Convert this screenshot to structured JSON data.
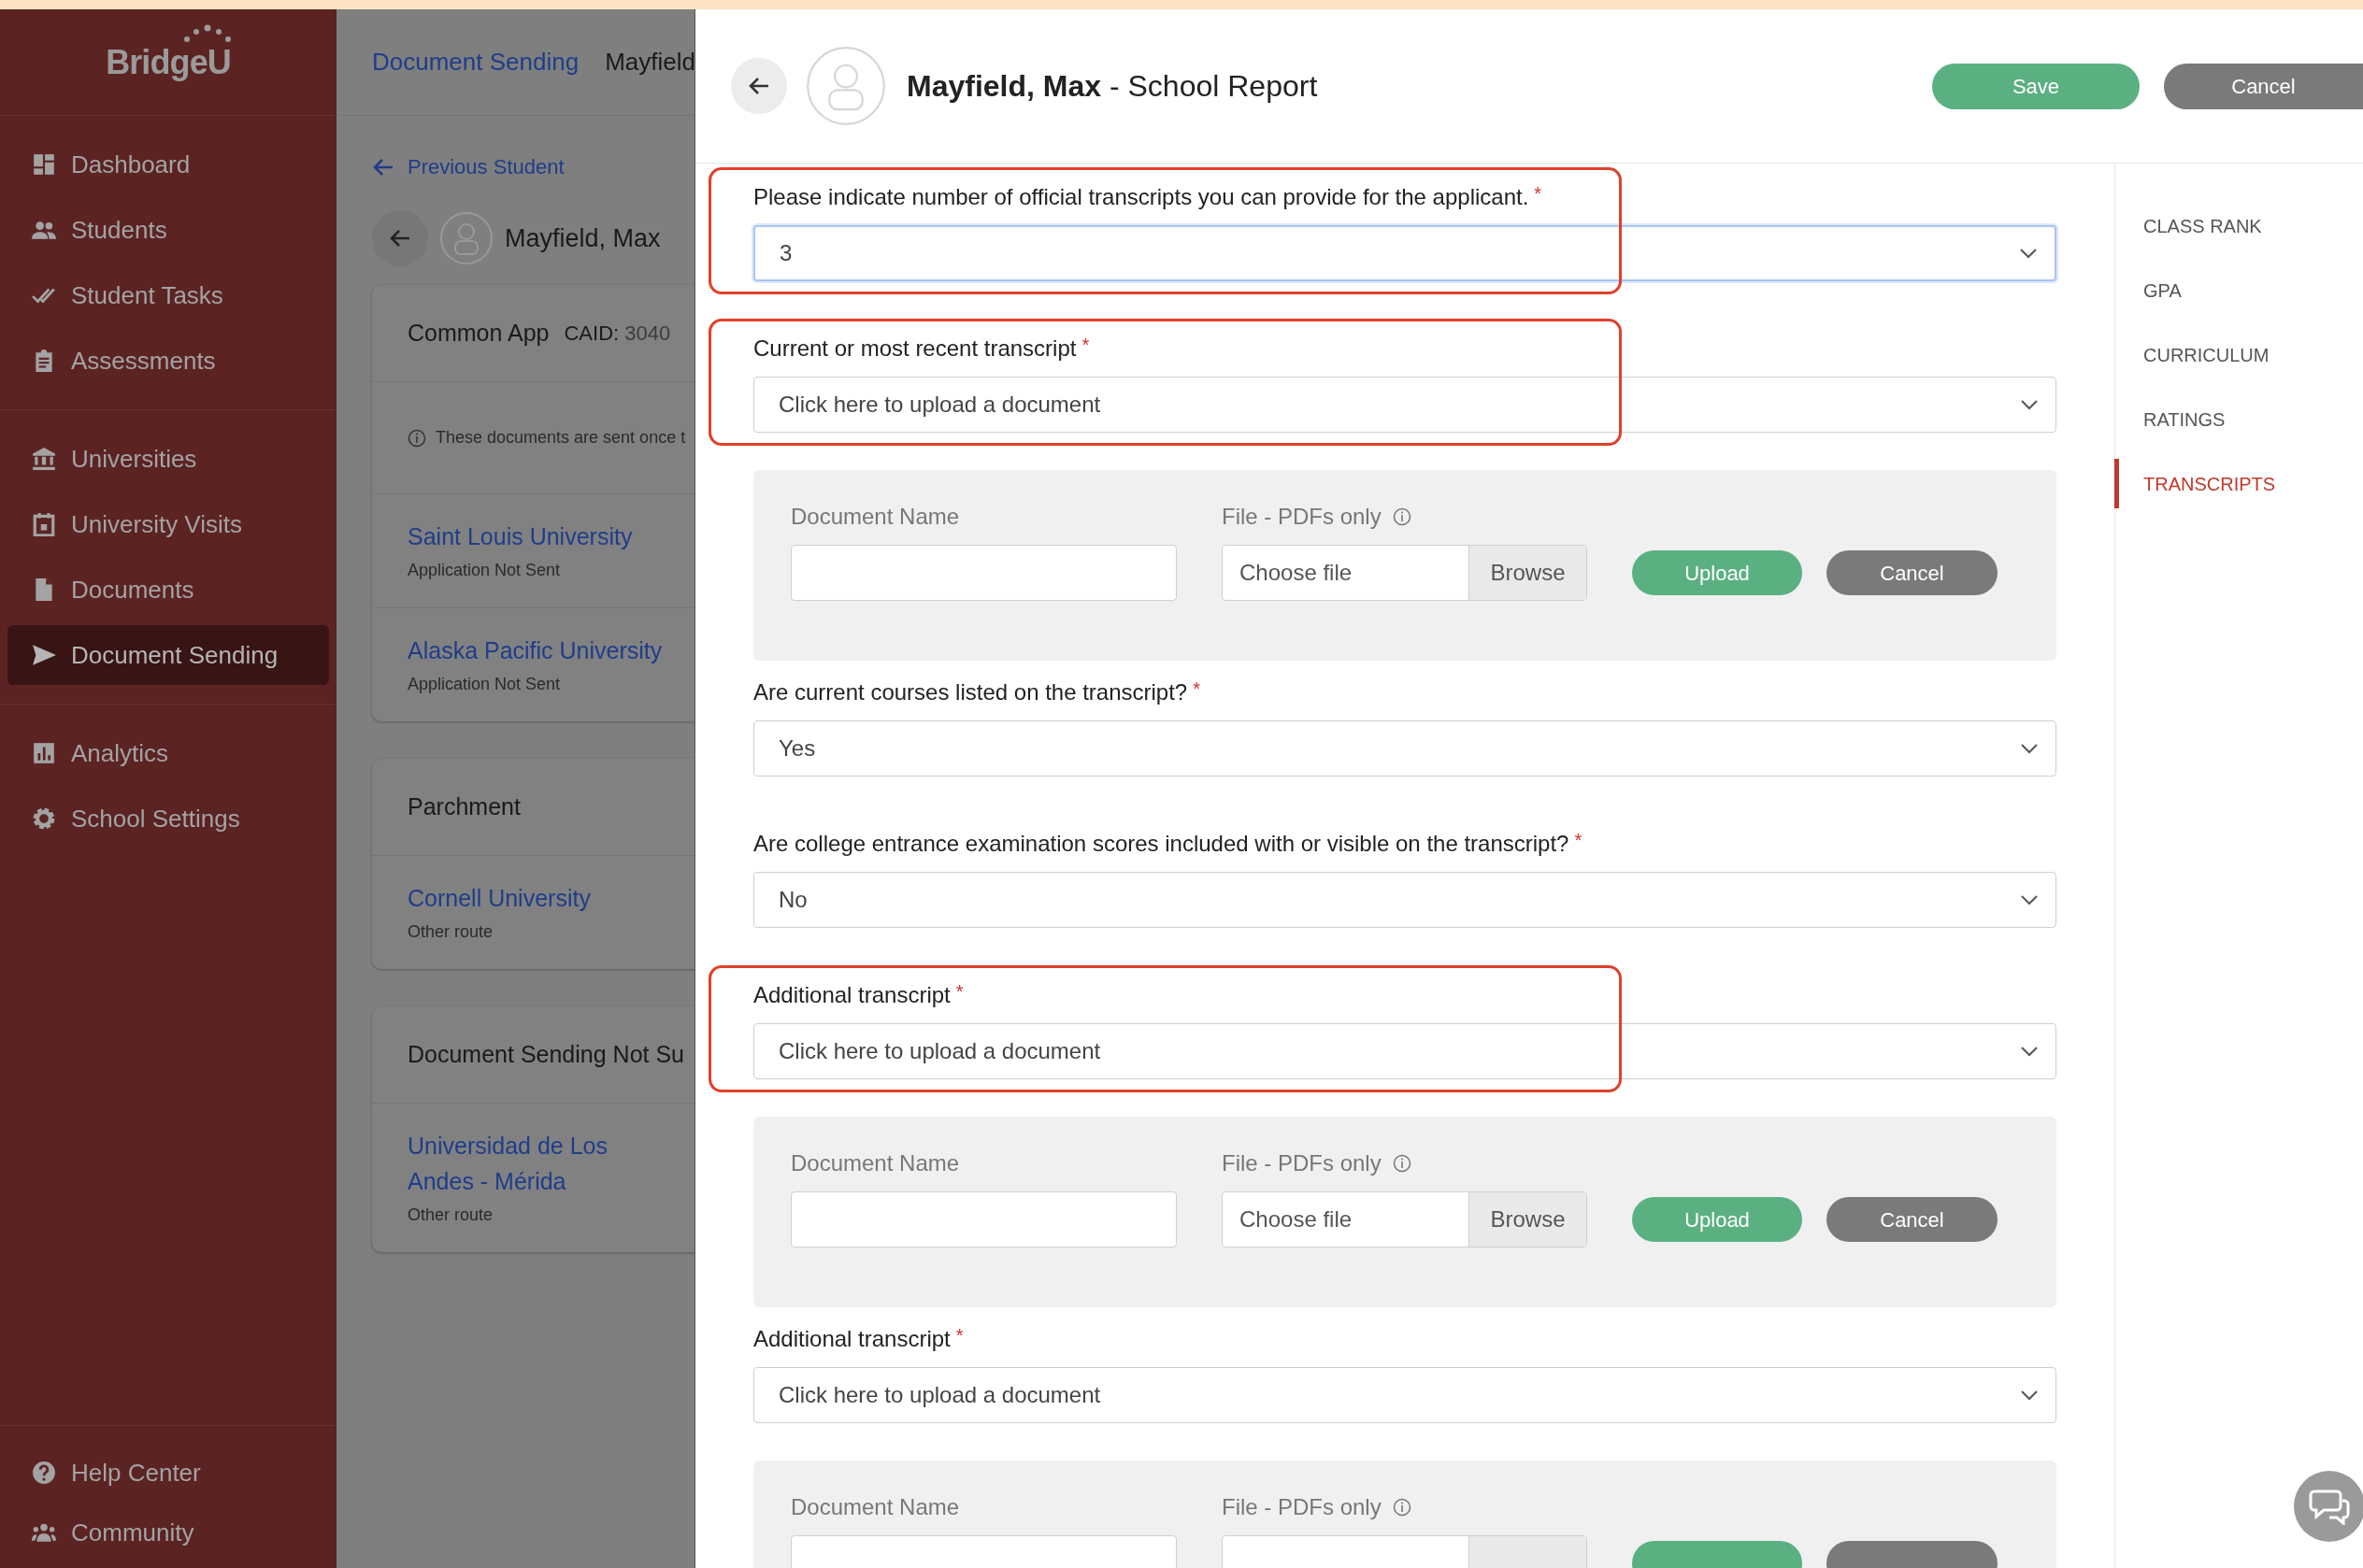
{
  "sidebar": {
    "logo": "BridgeU",
    "groups": [
      [
        {
          "label": "Dashboard",
          "selected": false
        },
        {
          "label": "Students",
          "selected": false
        },
        {
          "label": "Student Tasks",
          "selected": false
        },
        {
          "label": "Assessments",
          "selected": false
        }
      ],
      [
        {
          "label": "Universities",
          "selected": false
        },
        {
          "label": "University Visits",
          "selected": false
        },
        {
          "label": "Documents",
          "selected": false
        },
        {
          "label": "Document Sending",
          "selected": true
        }
      ],
      [
        {
          "label": "Analytics",
          "selected": false
        },
        {
          "label": "School Settings",
          "selected": false
        }
      ]
    ],
    "footer": [
      {
        "label": "Help Center"
      },
      {
        "label": "Community"
      }
    ]
  },
  "background_page": {
    "breadcrumb": [
      "Document Sending",
      "Mayfield"
    ],
    "previous_link": "Previous Student",
    "student_name": "Mayfield, Max",
    "cards": [
      {
        "title": "Common App",
        "caid_label": "CAID:",
        "caid_value": "3040",
        "note": "These documents are sent once t",
        "entries": [
          {
            "name": "Saint Louis University",
            "status": "Application Not Sent"
          },
          {
            "name": "Alaska Pacific University",
            "status": "Application Not Sent"
          }
        ]
      },
      {
        "title": "Parchment",
        "entries": [
          {
            "name": "Cornell University",
            "status": "Other route"
          }
        ]
      },
      {
        "title": "Document Sending Not Su",
        "entries": [
          {
            "name": "Universidad de Los Andes - Mérida",
            "status": "Other route"
          }
        ]
      }
    ]
  },
  "modal": {
    "title": "**Mayfield, Max** - School Report",
    "save": "Save",
    "cancel": "Cancel",
    "nav": [
      {
        "label": "CLASS RANK",
        "selected": false
      },
      {
        "label": "GPA",
        "selected": false
      },
      {
        "label": "CURRICULUM",
        "selected": false
      },
      {
        "label": "RATINGS",
        "selected": false
      },
      {
        "label": "TRANSCRIPTS",
        "selected": true
      }
    ],
    "fields": [
      {
        "kind": "select",
        "label": "Please indicate number of official transcripts you can provide for the applicant.",
        "required_mark": "*",
        "value": "3",
        "focused": true,
        "highlighted": true
      },
      {
        "kind": "select",
        "label": "Current or most recent transcript",
        "required_mark": "*",
        "value": "Click here to upload a document",
        "focused": false,
        "highlighted": true
      },
      {
        "kind": "upload",
        "name_label": "Document Name",
        "file_label": "File - PDFs only",
        "choose": "Choose file",
        "browse": "Browse",
        "upload": "Upload",
        "cancel": "Cancel"
      },
      {
        "kind": "select",
        "label": "Are current courses listed on the transcript?",
        "required_mark": "*",
        "value": "Yes",
        "focused": false,
        "highlighted": false
      },
      {
        "kind": "select",
        "label": "Are college entrance examination scores included with or visible on the transcript?",
        "required_mark": "*",
        "value": "No",
        "focused": false,
        "highlighted": false
      },
      {
        "kind": "select",
        "label": "Additional transcript",
        "required_mark": "*",
        "value": "Click here to upload a document",
        "focused": false,
        "highlighted": true
      },
      {
        "kind": "upload",
        "name_label": "Document Name",
        "file_label": "File - PDFs only",
        "choose": "Choose file",
        "browse": "Browse",
        "upload": "Upload",
        "cancel": "Cancel"
      },
      {
        "kind": "select",
        "label": "Additional transcript",
        "required_mark": "*",
        "value": "Click here to upload a document",
        "focused": false,
        "highlighted": false
      },
      {
        "kind": "upload",
        "name_label": "Document Name",
        "file_label": "File - PDFs only"
      }
    ]
  }
}
